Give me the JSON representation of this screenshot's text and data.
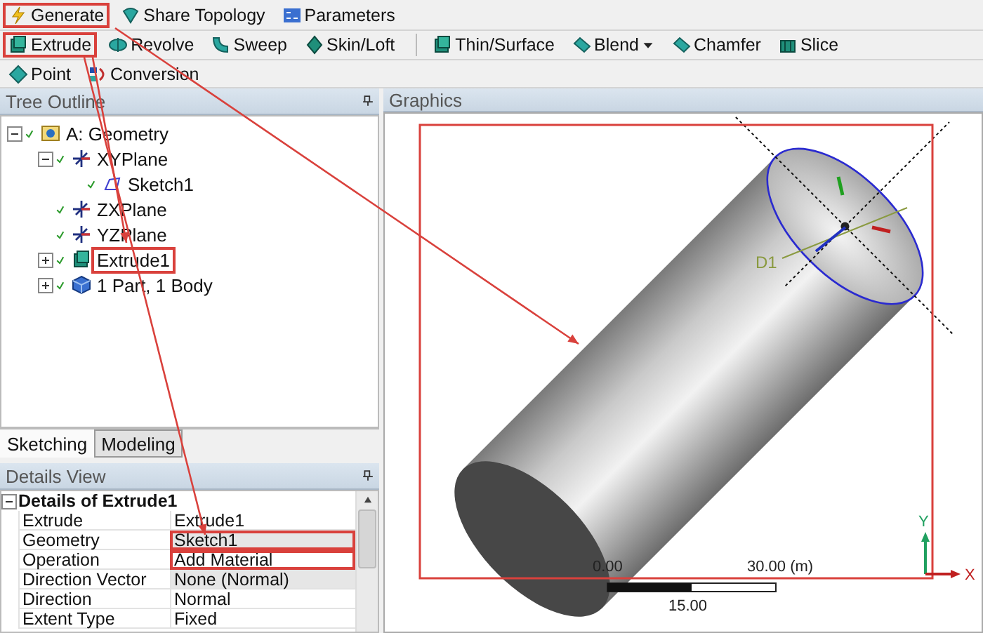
{
  "toolbars": [
    {
      "groups": [
        [
          {
            "label": "Generate",
            "kind": "lightning",
            "highlighted": true,
            "dropdown": false
          },
          {
            "label": "Share Topology",
            "kind": "share",
            "highlighted": false,
            "dropdown": false
          },
          {
            "label": "Parameters",
            "kind": "parameters",
            "highlighted": false,
            "dropdown": false
          }
        ]
      ]
    },
    {
      "groups": [
        [
          {
            "label": "Extrude",
            "kind": "extrude",
            "highlighted": true,
            "dropdown": false
          },
          {
            "label": "Revolve",
            "kind": "revolve",
            "highlighted": false,
            "dropdown": false
          },
          {
            "label": "Sweep",
            "kind": "sweep",
            "highlighted": false,
            "dropdown": false
          },
          {
            "label": "Skin/Loft",
            "kind": "loft",
            "highlighted": false,
            "dropdown": false
          }
        ],
        [
          {
            "label": "Thin/Surface",
            "kind": "extrude",
            "highlighted": false,
            "dropdown": false
          },
          {
            "label": "Blend",
            "kind": "blend",
            "highlighted": false,
            "dropdown": true
          },
          {
            "label": "Chamfer",
            "kind": "blend",
            "highlighted": false,
            "dropdown": false
          },
          {
            "label": "Slice",
            "kind": "slice",
            "highlighted": false,
            "dropdown": false
          }
        ]
      ]
    },
    {
      "groups": [
        [
          {
            "label": "Point",
            "kind": "point",
            "highlighted": false,
            "dropdown": false
          },
          {
            "label": "Conversion",
            "kind": "conversion",
            "highlighted": false,
            "dropdown": false
          }
        ]
      ]
    }
  ],
  "tree": {
    "title": "Tree Outline",
    "items": [
      {
        "label": "A: Geometry",
        "kind": "geometry",
        "expanded": true,
        "highlighted": false,
        "children": [
          {
            "label": "XYPlane",
            "kind": "plane",
            "expanded": true,
            "highlighted": false,
            "children": [
              {
                "label": "Sketch1",
                "kind": "sketch",
                "highlighted": false
              }
            ]
          },
          {
            "label": "ZXPlane",
            "kind": "plane",
            "highlighted": false
          },
          {
            "label": "YZPlane",
            "kind": "plane",
            "highlighted": false
          },
          {
            "label": "Extrude1",
            "kind": "extrude",
            "expanded": false,
            "highlighted": true
          },
          {
            "label": "1 Part, 1 Body",
            "kind": "body",
            "expanded": false,
            "highlighted": false
          }
        ]
      }
    ]
  },
  "tabs": [
    {
      "label": "Sketching",
      "selected": false
    },
    {
      "label": "Modeling",
      "selected": true
    }
  ],
  "details": {
    "title": "Details View",
    "group": {
      "title": "Details of Extrude1",
      "expanded": true
    },
    "rows": [
      {
        "label": "Extrude",
        "value": "Extrude1",
        "shaded": false,
        "highlighted": false
      },
      {
        "label": "Geometry",
        "value": "Sketch1",
        "shaded": true,
        "highlighted": true
      },
      {
        "label": "Operation",
        "value": "Add Material",
        "shaded": false,
        "highlighted": true
      },
      {
        "label": "Direction Vector",
        "value": "None (Normal)",
        "shaded": true,
        "highlighted": false
      },
      {
        "label": "Direction",
        "value": "Normal",
        "shaded": false,
        "highlighted": false
      },
      {
        "label": "Extent Type",
        "value": "Fixed",
        "shaded": false,
        "highlighted": false
      }
    ]
  },
  "graphics": {
    "title": "Graphics",
    "highlighted": true,
    "dimension_label": "D1",
    "scale": {
      "start": "0.00",
      "end": "30.00 (m)",
      "middle": "15.00"
    },
    "axes": {
      "y": "Y",
      "x": "X"
    }
  }
}
